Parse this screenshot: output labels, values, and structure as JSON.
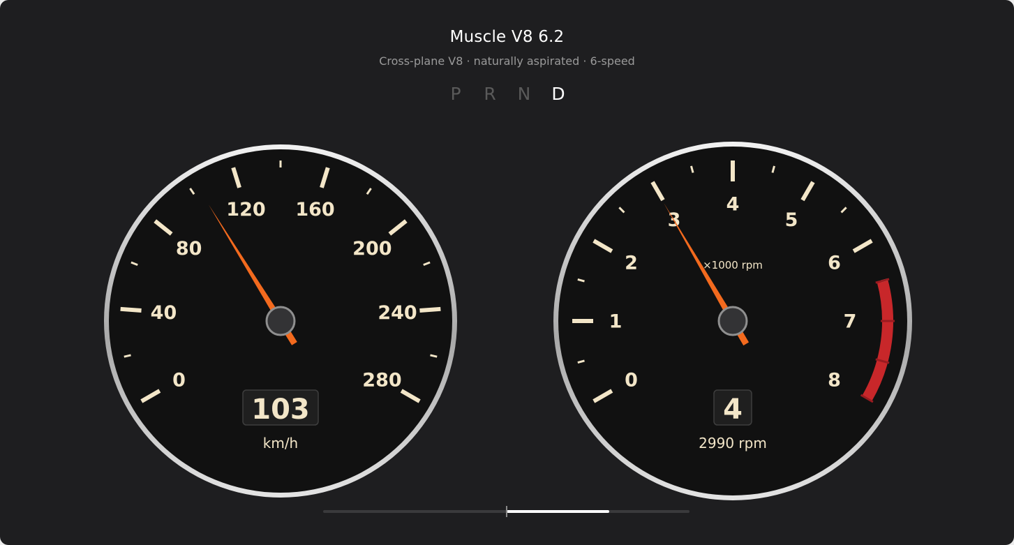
{
  "header": {
    "title": "Muscle V8 6.2",
    "subtitle": "Cross-plane V8 · naturally aspirated · 6-speed"
  },
  "gear_selector": {
    "options": [
      "P",
      "R",
      "N",
      "D"
    ],
    "selected": "D"
  },
  "speedometer": {
    "min": 0,
    "max": 280,
    "labels": [
      "0",
      "40",
      "80",
      "120",
      "160",
      "200",
      "240",
      "280"
    ],
    "value": 103,
    "readout": "103",
    "unit": "km/h"
  },
  "tachometer": {
    "min": 0,
    "max": 8,
    "labels": [
      "0",
      "1",
      "2",
      "3",
      "4",
      "5",
      "6",
      "7",
      "8"
    ],
    "caption": "×1000 rpm",
    "redline_from": 6.5,
    "value": 2.99,
    "gear_readout": "4",
    "rpm_readout": "2990 rpm"
  },
  "scrubber": {
    "progress": 0.781,
    "handle": 0.5,
    "fill_from": 0.5
  },
  "colors": {
    "background": "#1e1e20",
    "dial_face": "#111111",
    "tick": "#f3e6c8",
    "needle": "#f36a1e",
    "redline": "#c8272a",
    "bezel": "#cfcfcf"
  }
}
